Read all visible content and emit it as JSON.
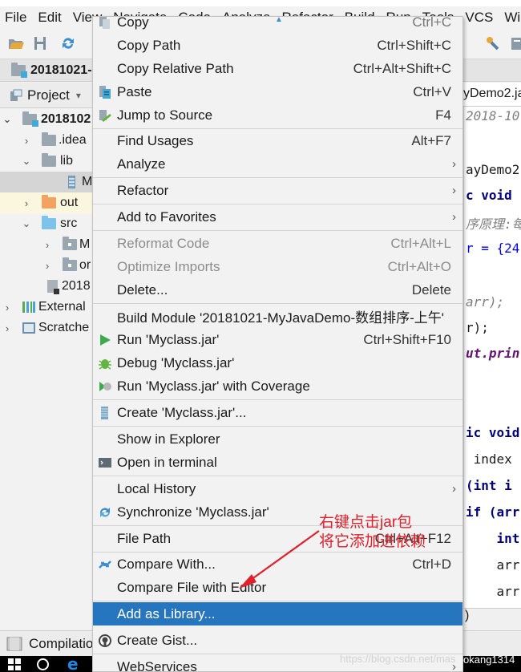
{
  "menubar": {
    "items": [
      "File",
      "Edit",
      "View",
      "Navigate",
      "Code",
      "Analyze",
      "Refactor",
      "Build",
      "Run",
      "Tools",
      "VCS",
      "Wi"
    ]
  },
  "navbar": {
    "project_crumb": "20181021-"
  },
  "project_panel": {
    "label": "Project",
    "dropdown_icon": "▾"
  },
  "tree": [
    {
      "label": "2018102",
      "type": "module",
      "arrow": "⌄",
      "bold": true
    },
    {
      "label": ".idea",
      "type": "folder",
      "arrow": "›"
    },
    {
      "label": "lib",
      "type": "folder",
      "arrow": "⌄"
    },
    {
      "label": "M",
      "type": "jar",
      "selected": true
    },
    {
      "label": "out",
      "type": "folder-orange",
      "arrow": "›"
    },
    {
      "label": "src",
      "type": "folder-blue",
      "arrow": "⌄"
    },
    {
      "label": "M",
      "type": "package",
      "arrow": "›"
    },
    {
      "label": "or",
      "type": "package",
      "arrow": "›"
    },
    {
      "label": "2018",
      "type": "file"
    },
    {
      "label": "External",
      "type": "libraries",
      "arrow": "›"
    },
    {
      "label": "Scratche",
      "type": "scratches",
      "arrow": "›"
    }
  ],
  "editor": {
    "tab_label": "yDemo2.ja",
    "lines": [
      {
        "text": "2018-10",
        "style": "cmt"
      },
      {
        "text": "ayDemo2",
        "style": "plain"
      },
      {
        "text": "c void",
        "style": "kw"
      },
      {
        "text": "序原理:每",
        "style": "cmt"
      },
      {
        "text": "r = {24",
        "style": "mixed"
      },
      {
        "text": "arr);",
        "style": "cmt"
      },
      {
        "text": "r);",
        "style": "plain"
      },
      {
        "text": "ut.prin",
        "style": "fld"
      },
      {
        "text": "ic void",
        "style": "kw"
      },
      {
        "text": " index",
        "style": "plain"
      },
      {
        "text": "(int i",
        "style": "mixed"
      },
      {
        "text": "if (arr",
        "style": "mixed"
      },
      {
        "text": "    int",
        "style": "kw"
      },
      {
        "text": "    arr",
        "style": "plain"
      },
      {
        "text": "    arr",
        "style": "plain"
      }
    ],
    "bottom_text": ")"
  },
  "bottom_panel": {
    "label": "Compilatio"
  },
  "context_menu": {
    "items": [
      {
        "label": "Copy",
        "shortcut": "Ctrl+C",
        "icon": "copy-icon",
        "partial": true
      },
      {
        "label": "Copy Path",
        "shortcut": "Ctrl+Shift+C"
      },
      {
        "label": "Copy Relative Path",
        "shortcut": "Ctrl+Alt+Shift+C"
      },
      {
        "label": "Paste",
        "shortcut": "Ctrl+V",
        "icon": "paste-icon"
      },
      {
        "label": "Jump to Source",
        "shortcut": "F4",
        "icon": "jump-to-source-icon"
      },
      {
        "label": "Find Usages",
        "shortcut": "Alt+F7"
      },
      {
        "label": "Analyze",
        "submenu": true
      },
      {
        "label": "Refactor",
        "submenu": true
      },
      {
        "label": "Add to Favorites",
        "submenu": true
      },
      {
        "label": "Reformat Code",
        "shortcut": "Ctrl+Alt+L",
        "disabled": true
      },
      {
        "label": "Optimize Imports",
        "shortcut": "Ctrl+Alt+O",
        "disabled": true
      },
      {
        "label": "Delete...",
        "shortcut": "Delete"
      },
      {
        "label": "Build Module '20181021-MyJavaDemo-数组排序-上午'"
      },
      {
        "label": "Run 'Myclass.jar'",
        "shortcut": "Ctrl+Shift+F10",
        "icon": "run-icon"
      },
      {
        "label": "Debug 'Myclass.jar'",
        "icon": "debug-icon"
      },
      {
        "label": "Run 'Myclass.jar' with Coverage",
        "icon": "coverage-icon"
      },
      {
        "label": "Create 'Myclass.jar'...",
        "icon": "jar-icon"
      },
      {
        "label": "Show in Explorer"
      },
      {
        "label": "Open in terminal",
        "icon": "terminal-icon"
      },
      {
        "label": "Local History",
        "submenu": true
      },
      {
        "label": "Synchronize 'Myclass.jar'",
        "icon": "sync-icon"
      },
      {
        "label": "File Path",
        "shortcut": "Ctrl+Alt+F12"
      },
      {
        "label": "Compare With...",
        "shortcut": "Ctrl+D",
        "icon": "compare-icon"
      },
      {
        "label": "Compare File with Editor"
      },
      {
        "label": "Add as Library...",
        "active": true
      },
      {
        "label": "Create Gist...",
        "icon": "github-icon"
      },
      {
        "label": "WebServices",
        "submenu": true
      }
    ],
    "submenu_glyph": "›",
    "highlight_color": "#2675bf"
  },
  "annotation": {
    "line1": "右键点击jar包",
    "line2": "将它添加进依赖",
    "color": "#e0202a"
  },
  "watermark": {
    "text": "https://blog.csdn.net/mas",
    "tail": "okang1314"
  }
}
